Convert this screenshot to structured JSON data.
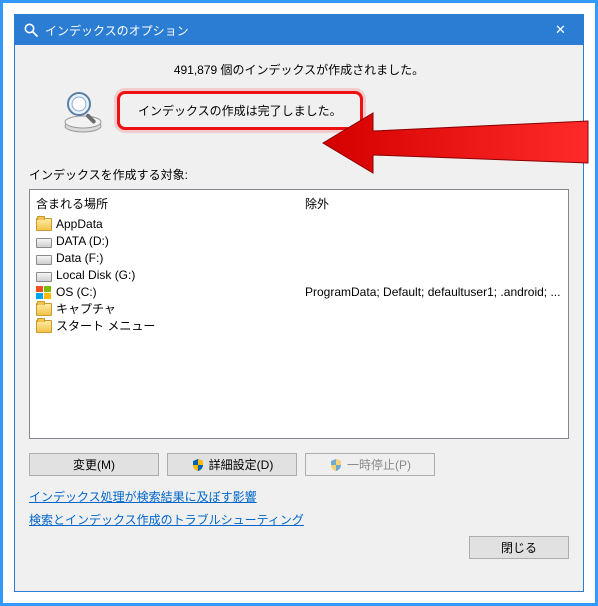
{
  "window": {
    "title": "インデックスのオプション",
    "close_glyph": "✕"
  },
  "status": {
    "count_line": "491,879 個のインデックスが作成されました。",
    "complete_line": "インデックスの作成は完了しました。"
  },
  "list": {
    "label": "インデックスを作成する対象:",
    "columns": {
      "included": "含まれる場所",
      "excluded": "除外"
    },
    "rows": [
      {
        "icon": "folder",
        "name": "AppData",
        "excluded": ""
      },
      {
        "icon": "drive",
        "name": "DATA (D:)",
        "excluded": ""
      },
      {
        "icon": "drive",
        "name": "Data (F:)",
        "excluded": ""
      },
      {
        "icon": "drive",
        "name": "Local Disk (G:)",
        "excluded": ""
      },
      {
        "icon": "win",
        "name": "OS (C:)",
        "excluded": "ProgramData; Default; defaultuser1; .android; ..."
      },
      {
        "icon": "folder",
        "name": "キャプチャ",
        "excluded": ""
      },
      {
        "icon": "folder",
        "name": "スタート メニュー",
        "excluded": ""
      }
    ]
  },
  "buttons": {
    "modify": "変更(M)",
    "advanced": "詳細設定(D)",
    "pause": "一時停止(P)",
    "close": "閉じる"
  },
  "links": {
    "help1": "インデックス処理が検索結果に及ぼす影響",
    "help2": "検索とインデックス作成のトラブルシューティング"
  }
}
